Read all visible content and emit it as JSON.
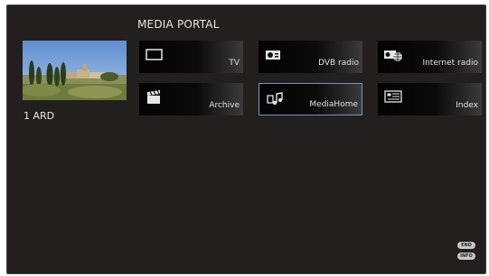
{
  "portal": {
    "title": "MEDIA PORTAL"
  },
  "preview": {
    "channel": "1  ARD"
  },
  "tiles": [
    {
      "label": "TV",
      "icon": "tv-icon"
    },
    {
      "label": "DVB radio",
      "icon": "radio-icon"
    },
    {
      "label": "Internet radio",
      "icon": "internet-radio-icon"
    },
    {
      "label": "Archive",
      "icon": "archive-icon"
    },
    {
      "label": "MediaHome",
      "icon": "media-home-icon",
      "selected": true
    },
    {
      "label": "Index",
      "icon": "index-icon"
    }
  ],
  "buttons": {
    "end": "END",
    "info": "INFO"
  },
  "colors": {
    "background": "#221f1e",
    "selection_border": "#7e93b4",
    "text": "#e8e8e8"
  }
}
